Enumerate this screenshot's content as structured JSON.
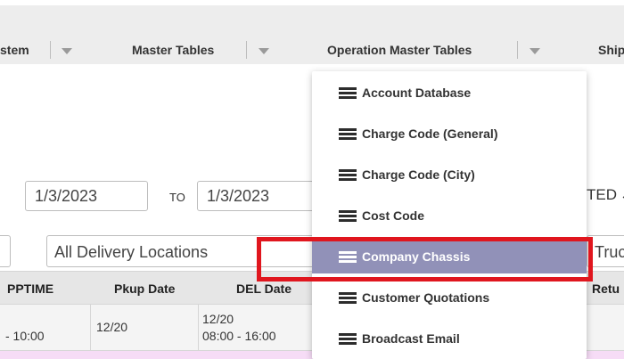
{
  "nav": {
    "items": [
      {
        "label": "stem"
      },
      {
        "label": "Master Tables"
      },
      {
        "label": "Operation Master Tables"
      },
      {
        "label": "Ship"
      }
    ]
  },
  "filters": {
    "from_date": "1/3/2023",
    "to_label": "TO",
    "to_date": "1/3/2023",
    "status_partial": "TED",
    "delivery_location": "All Delivery Locations",
    "truck_partial": "Truc"
  },
  "table": {
    "headers": [
      "PPTIME",
      "Pkup Date",
      "DEL Date",
      "Retu"
    ],
    "rows": [
      {
        "pptime": "- 10:00",
        "pkup_date": "12/20",
        "del_date_line1": "12/20",
        "del_date_line2": "08:00 - 16:00"
      }
    ]
  },
  "dropdown": {
    "items": [
      {
        "label": "Account Database",
        "active": false
      },
      {
        "label": "Charge Code (General)",
        "active": false
      },
      {
        "label": "Charge Code (City)",
        "active": false
      },
      {
        "label": "Cost Code",
        "active": false
      },
      {
        "label": "Company Chassis",
        "active": true
      },
      {
        "label": "Customer Quotations",
        "active": false
      },
      {
        "label": "Broadcast Email",
        "active": false
      }
    ]
  },
  "colors": {
    "menu_active_bg": "#9191b8",
    "highlight_border": "#e0161e",
    "row_pink": "#f6dcf6"
  }
}
